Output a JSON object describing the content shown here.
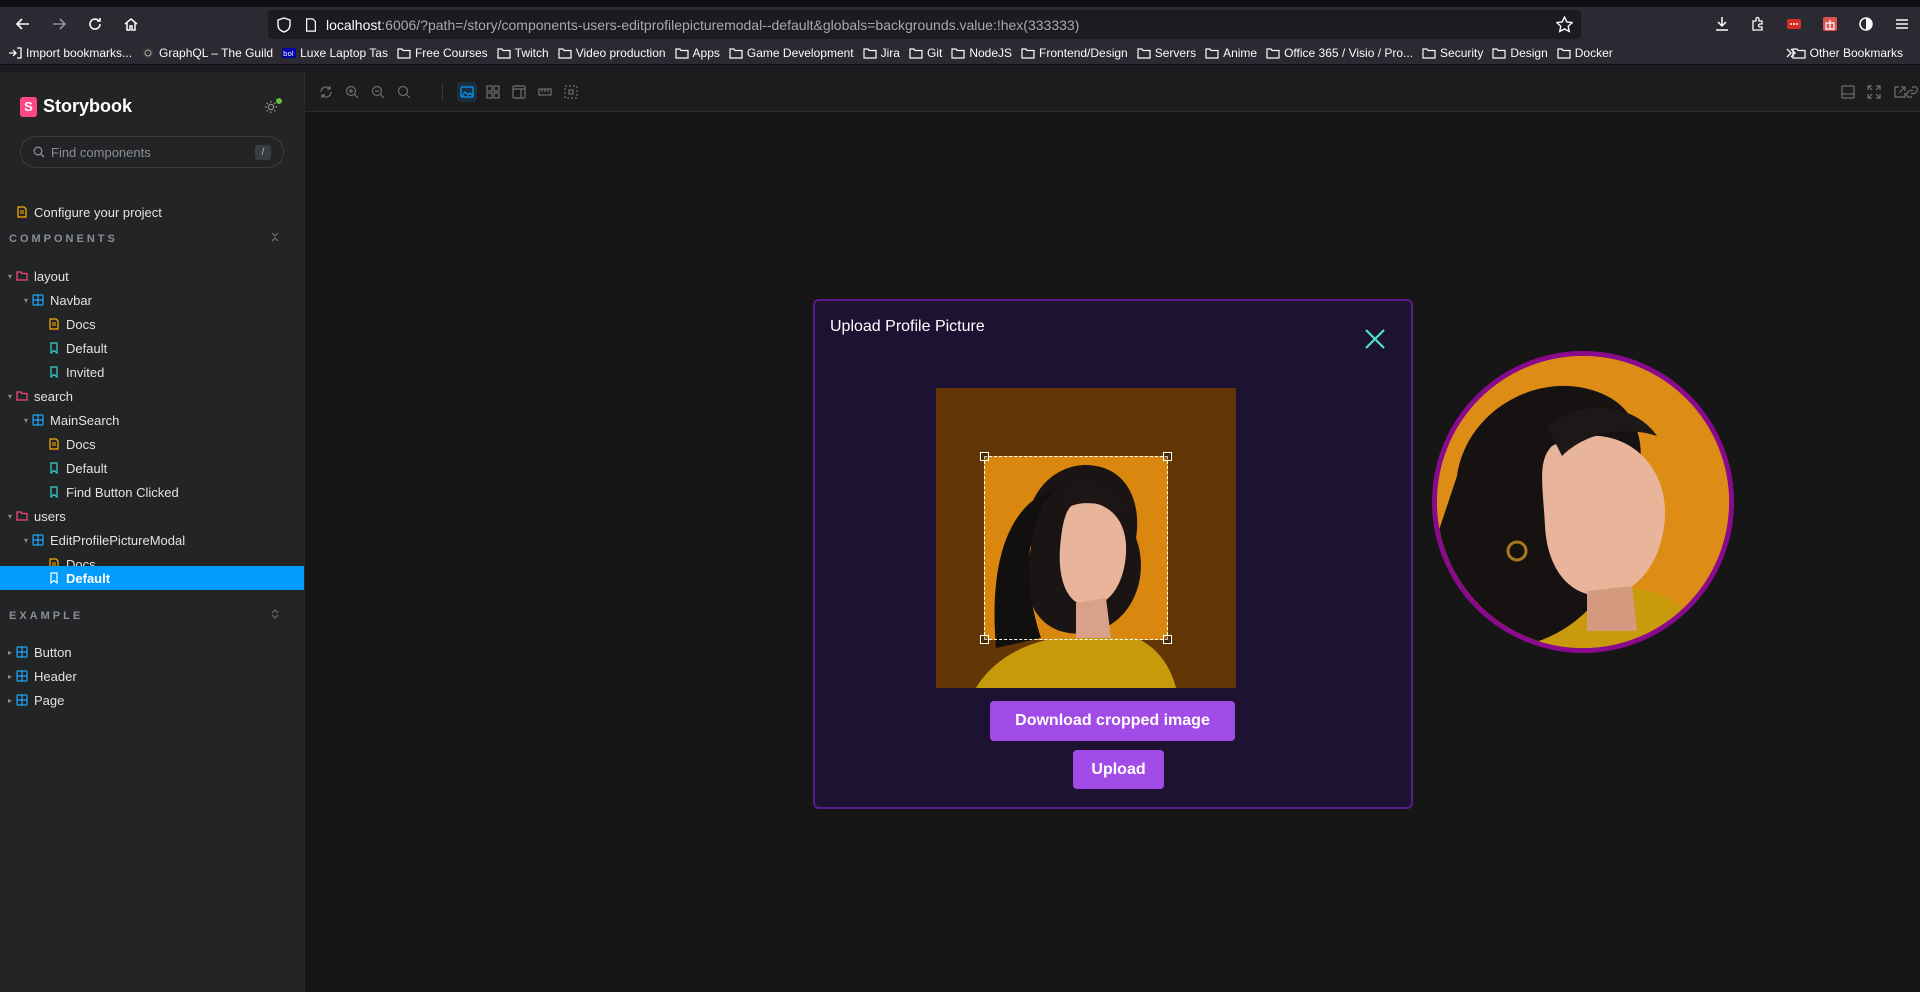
{
  "browser": {
    "url_host": "localhost",
    "url_rest": ":6006/?path=/story/components-users-editprofilepicturemodal--default&globals=backgrounds.value:!hex(333333)",
    "bookmarks": [
      "Import bookmarks...",
      "GraphQL – The Guild",
      "Luxe Laptop Tas",
      "Free Courses",
      "Twitch",
      "Video production",
      "Apps",
      "Game Development",
      "Jira",
      "Git",
      "NodeJS",
      "Frontend/Design",
      "Servers",
      "Anime",
      "Office 365 / Visio / Pro...",
      "Security",
      "Design",
      "Docker"
    ],
    "other_bookmarks": "Other Bookmarks"
  },
  "storybook": {
    "title": "Storybook",
    "search_placeholder": "Find components",
    "search_shortcut": "/",
    "configure": "Configure your project",
    "components_section": "COMPONENTS",
    "example_section": "EXAMPLE",
    "tree": {
      "layout": "layout",
      "navbar": "Navbar",
      "navbar_docs": "Docs",
      "navbar_default": "Default",
      "navbar_invited": "Invited",
      "search": "search",
      "mainsearch": "MainSearch",
      "mainsearch_docs": "Docs",
      "mainsearch_default": "Default",
      "mainsearch_find": "Find Button Clicked",
      "users": "users",
      "editprofile": "EditProfilePictureModal",
      "editprofile_docs": "Docs",
      "editprofile_default": "Default",
      "button": "Button",
      "header": "Header",
      "page": "Page"
    }
  },
  "modal": {
    "title": "Upload Profile Picture",
    "download_label": "Download cropped image",
    "upload_label": "Upload"
  },
  "colors": {
    "accent": "#a24ce8",
    "modal_bg": "#1e1232",
    "modal_border": "#5b1a8e",
    "close": "#50e3c2",
    "avatar_border": "#8a0a8e",
    "sb_selected": "#029cfd"
  }
}
